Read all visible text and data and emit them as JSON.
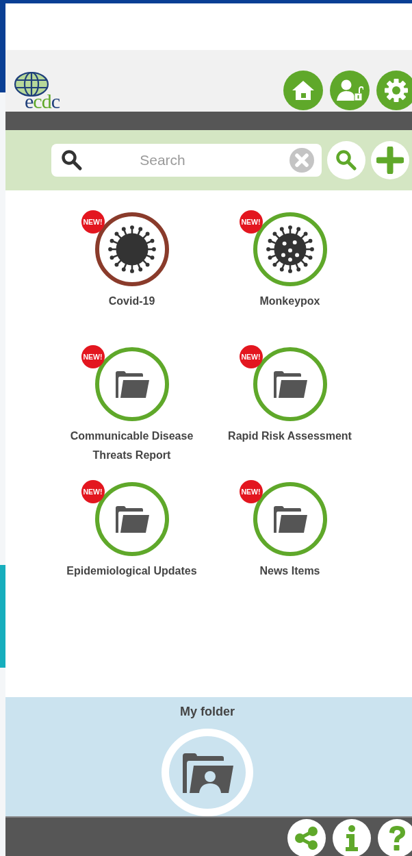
{
  "logo": "ecdc",
  "search": {
    "placeholder": "Search"
  },
  "topics": [
    {
      "label": "Covid-19",
      "kind": "virus",
      "color": "#8a3b2b",
      "badge": "NEW!"
    },
    {
      "label": "Monkeypox",
      "kind": "virus-spotted",
      "color": "#5fa82a",
      "badge": "NEW!"
    },
    {
      "label": "Communicable Disease Threats Report",
      "kind": "folder",
      "color": "#5fa82a",
      "badge": "NEW!"
    },
    {
      "label": "Rapid Risk Assessment",
      "kind": "folder",
      "color": "#5fa82a",
      "badge": "NEW!"
    },
    {
      "label": "Epidemiological Updates",
      "kind": "folder",
      "color": "#5fa82a",
      "badge": "NEW!"
    },
    {
      "label": "News Items",
      "kind": "folder",
      "color": "#5fa82a",
      "badge": "NEW!"
    }
  ],
  "my_folder": {
    "label": "My folder"
  }
}
